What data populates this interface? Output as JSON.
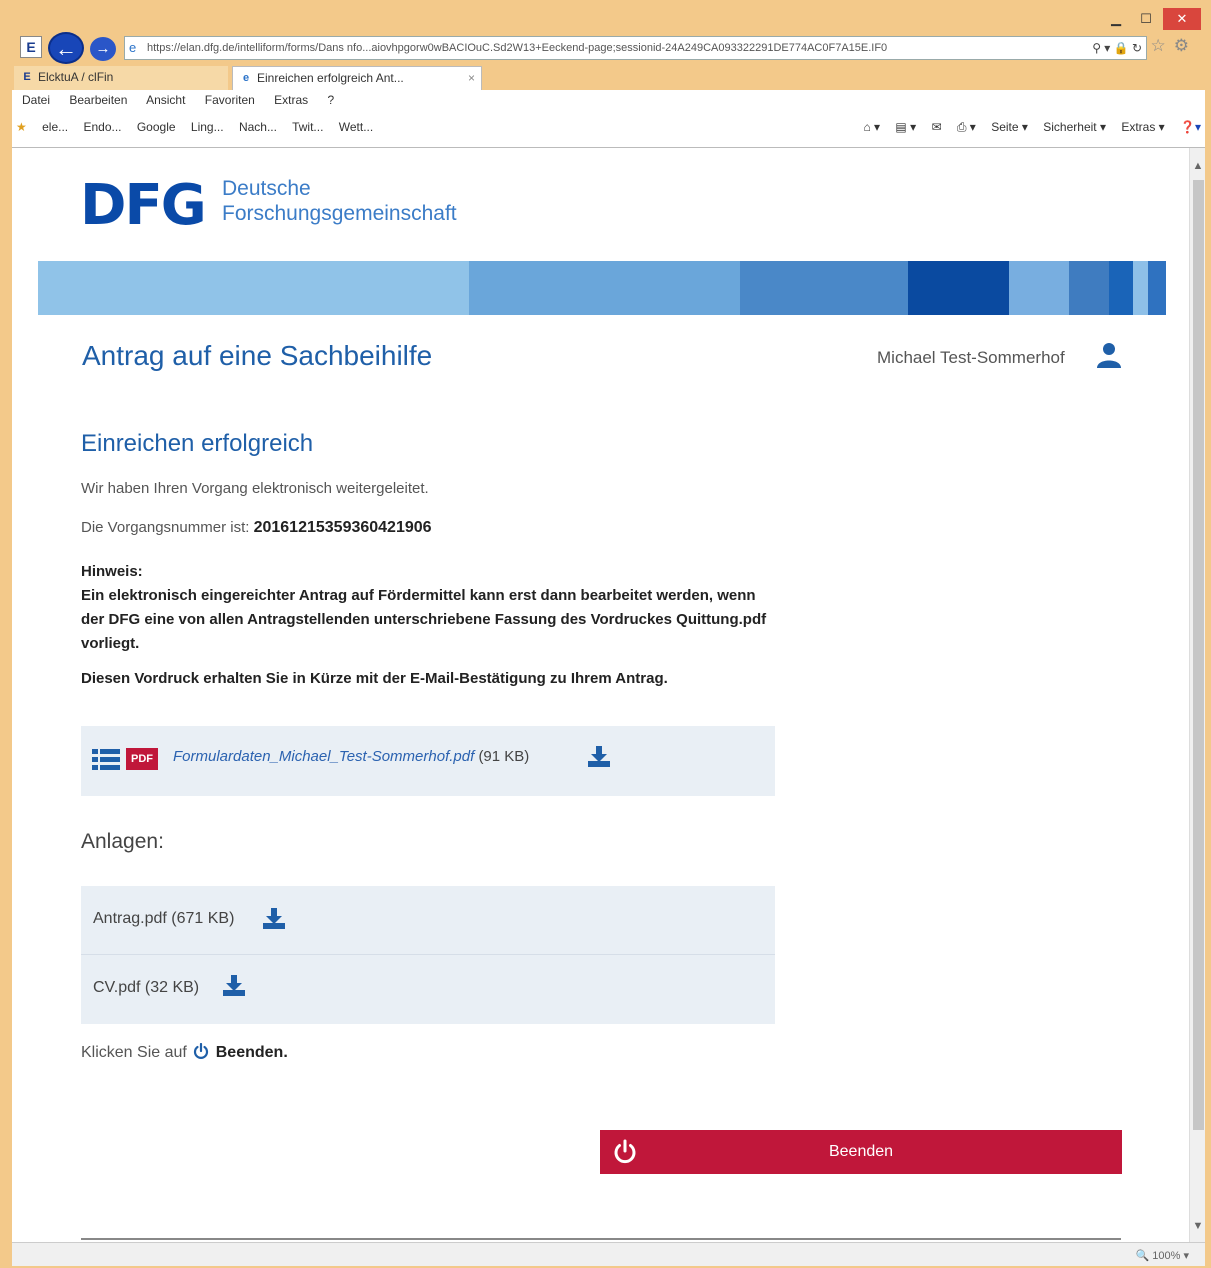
{
  "browser": {
    "url": "https://elan.dfg.de/intelliform/forms/Dans nfo...aiovhpgorw0wBACIOuC.Sd2W13+Eeckend-page;sessionid-24A249CA093322291DE774AC0F7A15E.IF0",
    "tabs": [
      {
        "label": "ElcktuA / clFin"
      },
      {
        "label": "Einreichen erfolgreich   Ant..."
      }
    ],
    "menu": [
      "Datei",
      "Bearbeiten",
      "Ansicht",
      "Favoriten",
      "Extras",
      "?"
    ],
    "favorites": [
      "ele...",
      "Endo...",
      "Google",
      "Ling...",
      "Nach...",
      "Twit...",
      "Wett..."
    ],
    "toolbar_right": [
      "Seite ▾",
      "Sicherheit ▾",
      "Extras ▾"
    ],
    "zoom": "100%"
  },
  "header": {
    "logo": "DFG",
    "org_line1": "Deutsche",
    "org_line2": "Forschungsgemeinschaft"
  },
  "stripe_colors": [
    "#90c3e8",
    "#6aa6da",
    "#4a88c8",
    "#0a4aa0",
    "#78aee0",
    "#3f7cc0",
    "#1a64b8",
    "#8ec0e8",
    "#2f72c0"
  ],
  "page": {
    "title": "Antrag auf eine Sachbeihilfe",
    "user": "Michael Test-Sommerhof",
    "success_title": "Einreichen erfolgreich",
    "forwarded_msg": "Wir haben Ihren Vorgang elektronisch weitergeleitet.",
    "vorgang_label": "Die Vorgangsnummer ist:",
    "vorgang_number": "20161215359360421906",
    "hint_label": "Hinweis:",
    "hint_text": "Ein elektronisch eingereichter Antrag auf Fördermittel kann erst dann bearbeitet werden, wenn der DFG eine von allen Antragstellenden unterschriebene Fassung des Vordruckes Quittung.pdf vorliegt.",
    "hint_text2": "Diesen Vordruck erhalten Sie in Kürze mit der E-Mail-Bestätigung zu Ihrem Antrag.",
    "form_file": {
      "name": "Formulardaten_Michael_Test-Sommerhof.pdf",
      "size": "(91 KB)",
      "badge": "PDF"
    },
    "attachments_title": "Anlagen:",
    "attachments": [
      {
        "label": "Antrag.pdf (671 KB)"
      },
      {
        "label": "CV.pdf (32 KB)"
      }
    ],
    "instruction_prefix": "Klicken Sie auf",
    "instruction_action": "Beenden.",
    "finish_button": "Beenden"
  },
  "colors": {
    "brand_blue": "#1f5fa8",
    "logo_blue": "#0a4aa8",
    "accent_red": "#c0173a",
    "panel_bg": "#e9eff5"
  }
}
